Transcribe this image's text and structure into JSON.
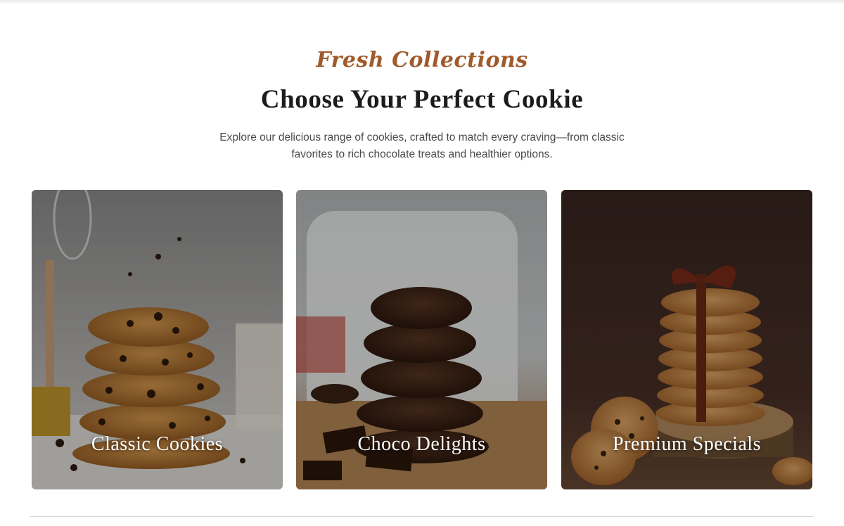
{
  "section": {
    "eyebrow": "Fresh Collections",
    "title": "Choose Your Perfect Cookie",
    "description": "Explore our delicious range of cookies, crafted to match every craving—from classic favorites to rich chocolate treats and healthier options."
  },
  "cards": [
    {
      "label": "Classic Cookies",
      "image": "chocolate-chip-cookie-stack"
    },
    {
      "label": "Choco Delights",
      "image": "double-chocolate-cookie-stack-with-milk"
    },
    {
      "label": "Premium Specials",
      "image": "ribbon-tied-cookie-stack"
    }
  ],
  "colors": {
    "accent": "#a05a2c",
    "heading": "#1c1c1c",
    "body_text": "#4a4a4a"
  }
}
